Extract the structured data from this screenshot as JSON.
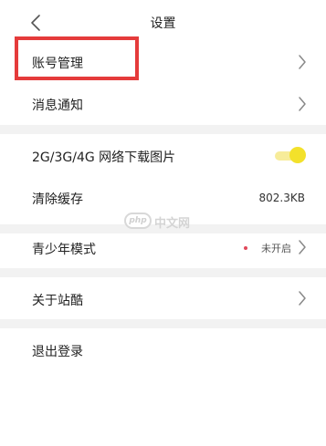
{
  "header": {
    "title": "设置"
  },
  "icons": {
    "back": "chevron-left-icon",
    "row_arrow": "chevron-right-icon"
  },
  "account": {
    "label": "账号管理"
  },
  "notifications": {
    "label": "消息通知"
  },
  "network_images": {
    "label": "2G/3G/4G 网络下载图片",
    "toggle_on": true
  },
  "cache": {
    "label": "清除缓存",
    "value": "802.3KB"
  },
  "teen_mode": {
    "label": "青少年模式",
    "status": "未开启"
  },
  "about": {
    "label": "关于站酷"
  },
  "logout": {
    "label": "退出登录"
  },
  "watermark": {
    "logo_text": "php",
    "text": "中文网"
  },
  "colors": {
    "highlight": "#e53b3b",
    "toggle_on": "#f3e12b",
    "status_dot": "#e0485a",
    "section_gap": "#f2f2f2"
  }
}
